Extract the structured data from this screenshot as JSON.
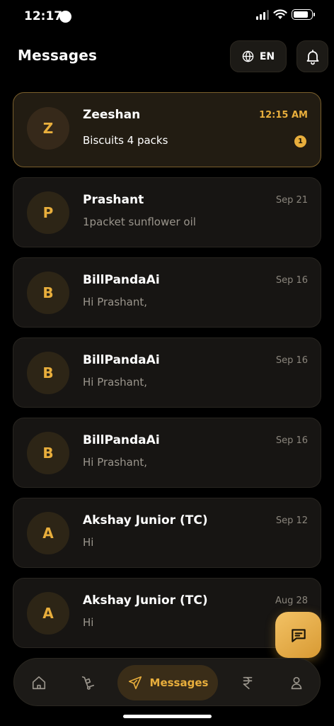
{
  "status_bar": {
    "time": "12:17"
  },
  "header": {
    "title": "Messages",
    "language": "EN"
  },
  "messages": [
    {
      "initial": "Z",
      "name": "Zeeshan",
      "preview": "Biscuits 4 packs",
      "time": "12:15 AM",
      "unread": "1"
    },
    {
      "initial": "P",
      "name": "Prashant",
      "preview": "1packet sunflower oil",
      "time": "Sep 21"
    },
    {
      "initial": "B",
      "name": "BillPandaAi",
      "preview": "Hi Prashant,",
      "time": "Sep 16"
    },
    {
      "initial": "B",
      "name": "BillPandaAi",
      "preview": "Hi Prashant,",
      "time": "Sep 16"
    },
    {
      "initial": "B",
      "name": "BillPandaAi",
      "preview": "Hi Prashant,",
      "time": "Sep 16"
    },
    {
      "initial": "A",
      "name": "Akshay Junior (TC)",
      "preview": "Hi",
      "time": "Sep 12"
    },
    {
      "initial": "A",
      "name": "Akshay Junior (TC)",
      "preview": "Hi",
      "time": "Aug 28"
    }
  ],
  "nav": {
    "messages_label": "Messages"
  },
  "colors": {
    "accent": "#e8ae3c",
    "background": "#000000",
    "card": "#171513"
  }
}
